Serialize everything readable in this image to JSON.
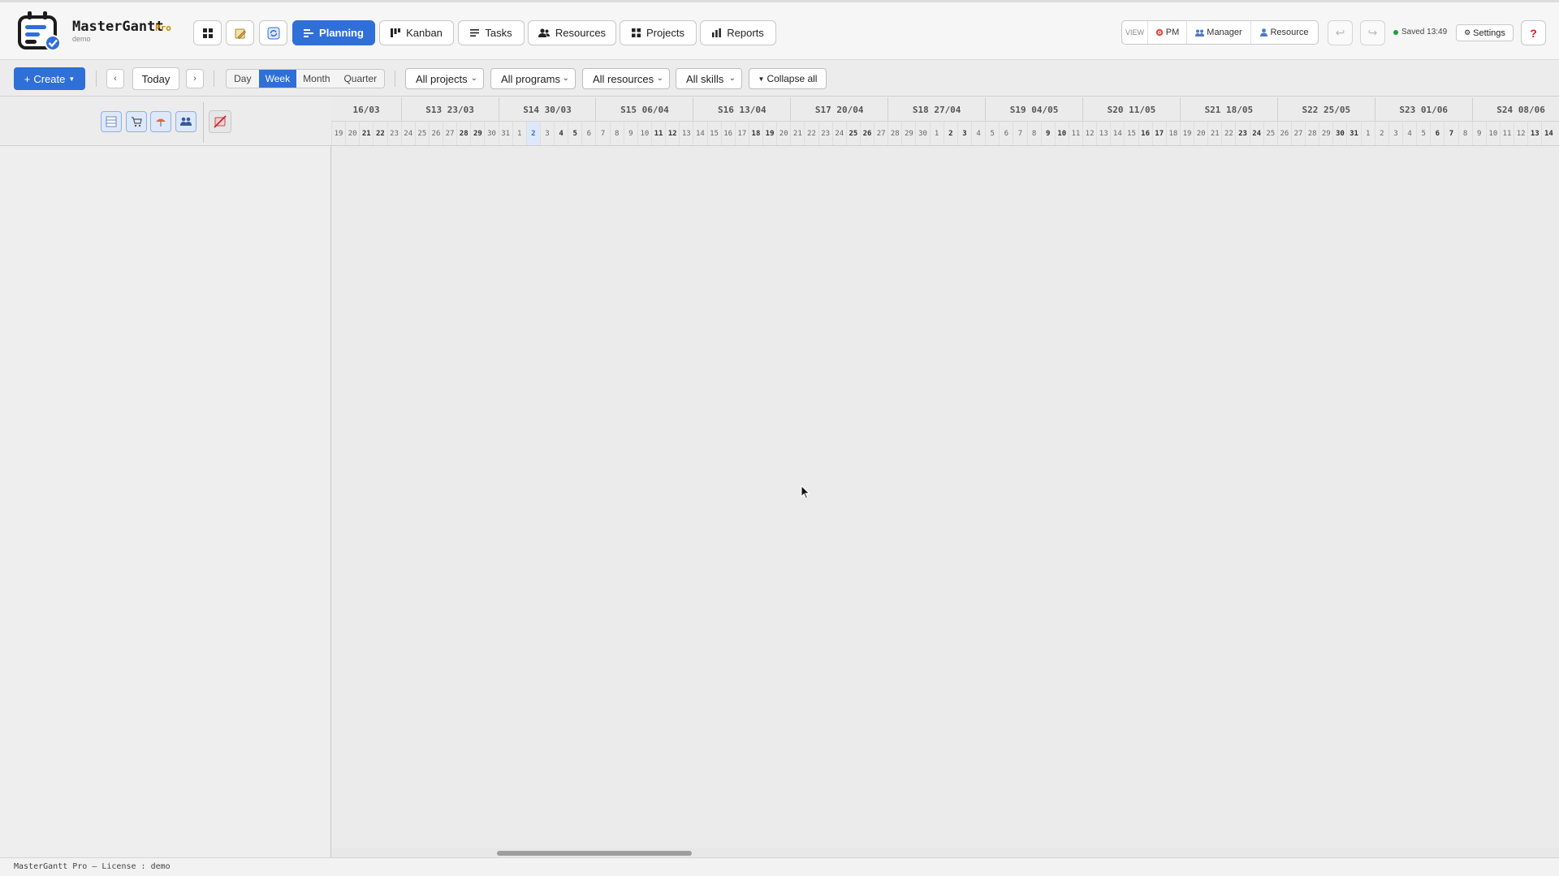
{
  "header": {
    "app_name": "MasterGantt",
    "edition": "Pro",
    "license": "demo",
    "nav": {
      "planning": "Planning",
      "kanban": "Kanban",
      "tasks": "Tasks",
      "resources": "Resources",
      "projects": "Projects",
      "reports": "Reports"
    },
    "active_tab": "Planning",
    "view": {
      "label": "VIEW",
      "pm": "PM",
      "manager": "Manager",
      "resource": "Resource"
    },
    "saved_status": "Saved 13:49",
    "settings_label": "Settings",
    "help_label": "?"
  },
  "toolbar": {
    "create_label": "Create",
    "prev_label": "‹",
    "today_label": "Today",
    "next_label": "›",
    "scale": {
      "day": "Day",
      "week": "Week",
      "month": "Month",
      "quarter": "Quarter"
    },
    "active_scale": "Week",
    "filters": {
      "projects": "All projects",
      "programs": "All programs",
      "resources": "All resources",
      "skills": "All skills"
    },
    "collapse_label": "Collapse all"
  },
  "timeline": {
    "weeks": [
      "16/03",
      "S13 23/03",
      "S14 30/03",
      "S15 06/04",
      "S16 13/04",
      "S17 20/04",
      "S18 27/04",
      "S19 04/05",
      "S20 11/05",
      "S21 18/05",
      "S22 25/05",
      "S23 01/06",
      "S24 08/06"
    ],
    "days": [
      "19",
      "20",
      "21",
      "22",
      "23",
      "24",
      "25",
      "26",
      "27",
      "28",
      "29",
      "30",
      "31",
      "1",
      "2",
      "3",
      "4",
      "5",
      "6",
      "7",
      "8",
      "9",
      "10",
      "11",
      "12",
      "13",
      "14",
      "15",
      "16",
      "17",
      "18",
      "19",
      "20",
      "21",
      "22",
      "23",
      "24",
      "25",
      "26",
      "27",
      "28",
      "29",
      "30",
      "1",
      "2",
      "3",
      "4",
      "5",
      "6",
      "7",
      "8",
      "9",
      "10",
      "11",
      "12",
      "13",
      "14",
      "15",
      "16",
      "17",
      "18",
      "19",
      "20",
      "21",
      "22",
      "23",
      "24",
      "25",
      "26",
      "27",
      "28",
      "29",
      "30",
      "31",
      "1",
      "2",
      "3",
      "4",
      "5",
      "6",
      "7",
      "8",
      "9",
      "10",
      "11",
      "12",
      "13",
      "14"
    ],
    "today_day": "2"
  },
  "footer": {
    "text": "MasterGantt Pro — License : demo"
  },
  "colors": {
    "accent": "#2f6fd8",
    "saved_dot": "#1e9e3e",
    "edition": "#c98a00",
    "help": "#d0202a"
  }
}
